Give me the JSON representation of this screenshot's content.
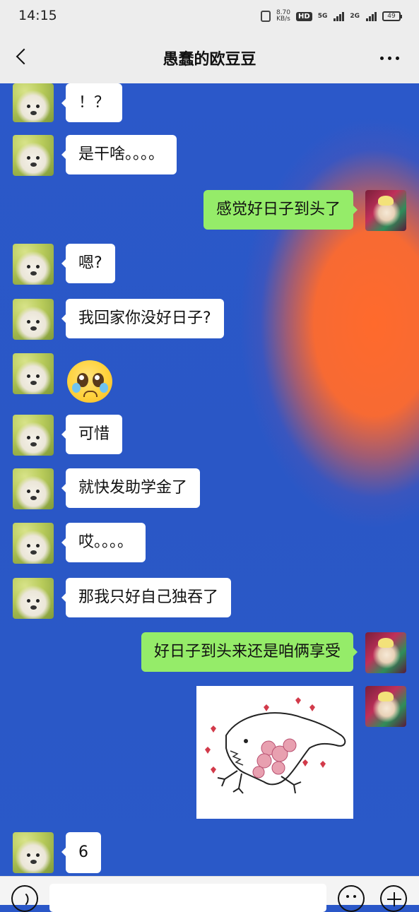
{
  "status_bar": {
    "time": "14:15",
    "net_speed_value": "8.70",
    "net_speed_unit": "KB/s",
    "hd_label": "HD",
    "signal_1_label": "5G",
    "signal_2_label": "2G",
    "battery": "49"
  },
  "header": {
    "title": "愚蠢的欧豆豆"
  },
  "messages": [
    {
      "side": "in",
      "text": "！？"
    },
    {
      "side": "in",
      "text": "是干啥。。。。"
    },
    {
      "side": "out",
      "text": "感觉好日子到头了"
    },
    {
      "side": "in",
      "text": "嗯?"
    },
    {
      "side": "in",
      "text": "我回家你没好日子?"
    },
    {
      "side": "in",
      "emoji": "pleading-face-emoji"
    },
    {
      "side": "in",
      "text": "可惜"
    },
    {
      "side": "in",
      "text": "就快发助学金了"
    },
    {
      "side": "in",
      "text": "哎。。。。"
    },
    {
      "side": "in",
      "text": "那我只好自己独吞了"
    },
    {
      "side": "out",
      "text": "好日子到头来还是咱俩享受"
    },
    {
      "side": "out",
      "sticker": "monster-with-roses-sticker"
    },
    {
      "side": "in",
      "text": "6"
    }
  ],
  "colors": {
    "chat_bg_blue": "#2a57c8",
    "chat_bg_orange": "#ff6a2c",
    "out_bubble": "#95ec69",
    "in_bubble": "#ffffff"
  }
}
